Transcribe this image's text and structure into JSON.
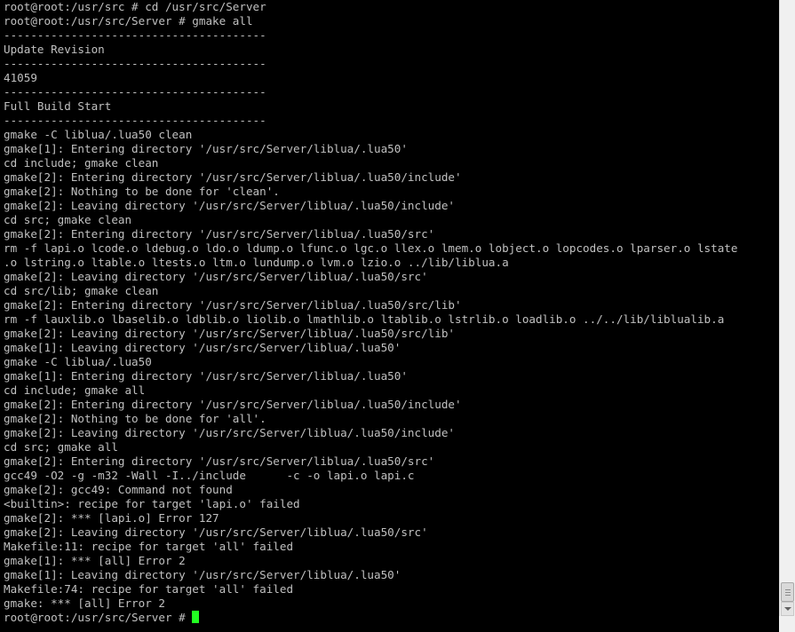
{
  "terminal": {
    "lines": [
      "root@root:/usr/src # cd /usr/src/Server",
      "root@root:/usr/src/Server # gmake all",
      "---------------------------------------",
      "Update Revision",
      "---------------------------------------",
      "41059",
      "---------------------------------------",
      "Full Build Start",
      "---------------------------------------",
      "gmake -C liblua/.lua50 clean",
      "gmake[1]: Entering directory '/usr/src/Server/liblua/.lua50'",
      "cd include; gmake clean",
      "gmake[2]: Entering directory '/usr/src/Server/liblua/.lua50/include'",
      "gmake[2]: Nothing to be done for 'clean'.",
      "gmake[2]: Leaving directory '/usr/src/Server/liblua/.lua50/include'",
      "cd src; gmake clean",
      "gmake[2]: Entering directory '/usr/src/Server/liblua/.lua50/src'",
      "rm -f lapi.o lcode.o ldebug.o ldo.o ldump.o lfunc.o lgc.o llex.o lmem.o lobject.o lopcodes.o lparser.o lstate",
      ".o lstring.o ltable.o ltests.o ltm.o lundump.o lvm.o lzio.o ../lib/liblua.a",
      "gmake[2]: Leaving directory '/usr/src/Server/liblua/.lua50/src'",
      "cd src/lib; gmake clean",
      "gmake[2]: Entering directory '/usr/src/Server/liblua/.lua50/src/lib'",
      "rm -f lauxlib.o lbaselib.o ldblib.o liolib.o lmathlib.o ltablib.o lstrlib.o loadlib.o ../../lib/liblualib.a",
      "gmake[2]: Leaving directory '/usr/src/Server/liblua/.lua50/src/lib'",
      "gmake[1]: Leaving directory '/usr/src/Server/liblua/.lua50'",
      "gmake -C liblua/.lua50",
      "gmake[1]: Entering directory '/usr/src/Server/liblua/.lua50'",
      "cd include; gmake all",
      "gmake[2]: Entering directory '/usr/src/Server/liblua/.lua50/include'",
      "gmake[2]: Nothing to be done for 'all'.",
      "gmake[2]: Leaving directory '/usr/src/Server/liblua/.lua50/include'",
      "cd src; gmake all",
      "gmake[2]: Entering directory '/usr/src/Server/liblua/.lua50/src'",
      "gcc49 -O2 -g -m32 -Wall -I../include      -c -o lapi.o lapi.c",
      "gmake[2]: gcc49: Command not found",
      "<builtin>: recipe for target 'lapi.o' failed",
      "gmake[2]: *** [lapi.o] Error 127",
      "gmake[2]: Leaving directory '/usr/src/Server/liblua/.lua50/src'",
      "Makefile:11: recipe for target 'all' failed",
      "gmake[1]: *** [all] Error 2",
      "gmake[1]: Leaving directory '/usr/src/Server/liblua/.lua50'",
      "Makefile:74: recipe for target 'all' failed",
      "gmake: *** [all] Error 2"
    ],
    "prompt": "root@root:/usr/src/Server # ",
    "cursor_color": "#22ff22",
    "text_color": "#c0c0c0",
    "background_color": "#000000"
  },
  "scrollbar": {
    "down_arrow_icon": "chevron-down-icon",
    "up_arrow_icon": "chevron-up-icon"
  }
}
